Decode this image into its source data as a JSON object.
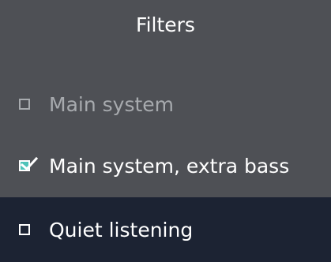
{
  "panel": {
    "title": "Filters"
  },
  "filters": [
    {
      "label": "Main system",
      "checked": false,
      "state": "disabled"
    },
    {
      "label": "Main system, extra bass",
      "checked": true,
      "state": "normal"
    },
    {
      "label": "Quiet listening",
      "checked": false,
      "state": "highlighted"
    }
  ],
  "colors": {
    "panel_background": "#4e5055",
    "highlight_background": "#1c2333",
    "check_accent": "#4fc3b9",
    "disabled_text": "#a7aaae",
    "text": "#ffffff"
  },
  "icons": {
    "unchecked": "checkbox-unchecked-icon",
    "checked": "checkbox-checked-icon"
  }
}
